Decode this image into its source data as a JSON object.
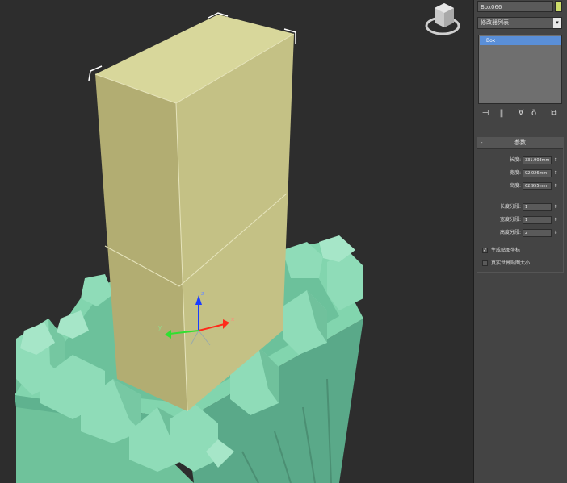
{
  "panel": {
    "object_name": "Box066",
    "object_color": "#cddc6a",
    "modifier_list": "修改器列表",
    "modifier_list_arrow": "▾",
    "stack_items": [
      "Box"
    ],
    "stack_tools": [
      "⊣",
      "‖",
      "∀",
      "ö",
      "⧉"
    ],
    "params": {
      "collapse": "-",
      "title": "参数",
      "length_label": "长度:",
      "length_value": "331.903mm",
      "width_label": "宽度:",
      "width_value": "92.026mm",
      "height_label": "高度:",
      "height_value": "62.955mm",
      "length_segs_label": "长度分段:",
      "length_segs": "1",
      "width_segs_label": "宽度分段:",
      "width_segs": "1",
      "height_segs_label": "高度分段:",
      "height_segs": "2",
      "spinner": "⇕",
      "gen_mapping": "生成贴图坐标",
      "gen_mapping_checked": "✓",
      "real_world": "真实世界贴图大小"
    }
  },
  "viewport": {
    "gizmo": {
      "x": "x",
      "y": "y",
      "z": "z"
    },
    "colors": {
      "box_front": "#b2ad72",
      "box_side": "#c4c185",
      "box_top": "#d8d79b",
      "castle_light": "#8fdcb8",
      "castle_mid": "#74c7a0",
      "castle_dark": "#55a585",
      "pink": "#d77ac6"
    }
  }
}
